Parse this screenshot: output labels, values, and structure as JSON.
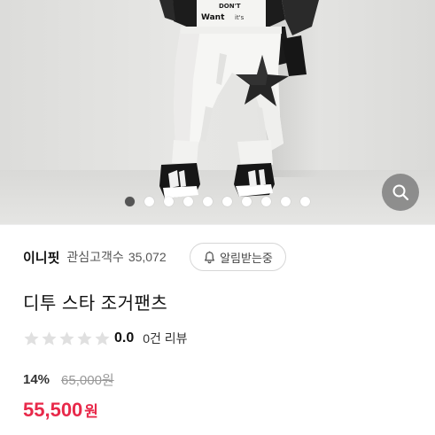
{
  "gallery": {
    "pagination": {
      "count": 10,
      "active_index": 0
    },
    "zoom_icon": "search-icon",
    "shirt_text": "Want",
    "shirt_text_top": "DON'T",
    "shirt_text_tail": "it's"
  },
  "seller": {
    "brand": "이니핏",
    "followers_label": "관심고객수",
    "followers_count": "35,072"
  },
  "notify": {
    "icon": "bell-icon",
    "label": "알림받는중"
  },
  "product": {
    "title": "디투 스타 조거팬츠"
  },
  "rating": {
    "stars_filled": 0,
    "stars_total": 5,
    "score": "0.0",
    "review_count": "0건 리뷰"
  },
  "price": {
    "discount_rate": "14%",
    "original": "65,000원",
    "sale": "55,500",
    "currency": "원"
  },
  "colors": {
    "sale_price": "#e8294a",
    "star_empty": "#e0e0e0",
    "dot_active": "#555555",
    "dot_inactive": "#ffffff"
  }
}
